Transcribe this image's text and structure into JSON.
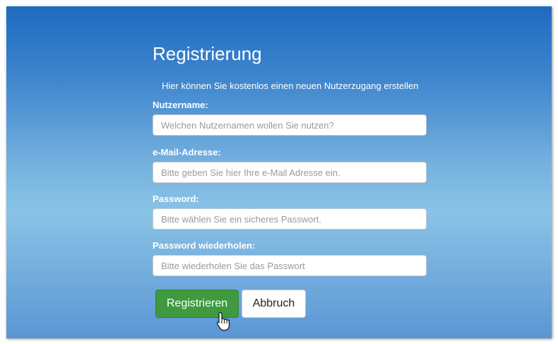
{
  "form": {
    "title": "Registrierung",
    "subtitle": "Hier können Sie kostenlos einen neuen Nutzerzugang erstellen",
    "fields": [
      {
        "label": "Nutzername:",
        "value": "",
        "placeholder": "Welchen Nutzernamen wollen Sie nutzen?"
      },
      {
        "label": "e-Mail-Adresse:",
        "value": "",
        "placeholder": "Bitte geben Sie hier Ihre e-Mail Adresse ein."
      },
      {
        "label": "Password:",
        "value": "",
        "placeholder": "Bitte wählen Sie ein sicheres Passwort."
      },
      {
        "label": "Password wiederholen:",
        "value": "",
        "placeholder": "Bitte wiederholen Sie das Passwort"
      }
    ],
    "submit_label": "Registrieren",
    "cancel_label": "Abbruch"
  },
  "colors": {
    "background_top": "#1e6ac0",
    "background_mid": "#88c3e6",
    "submit_button": "#3f9a3f",
    "cancel_button": "#ffffff"
  },
  "icons": {
    "cursor": "hand-pointer-icon"
  }
}
